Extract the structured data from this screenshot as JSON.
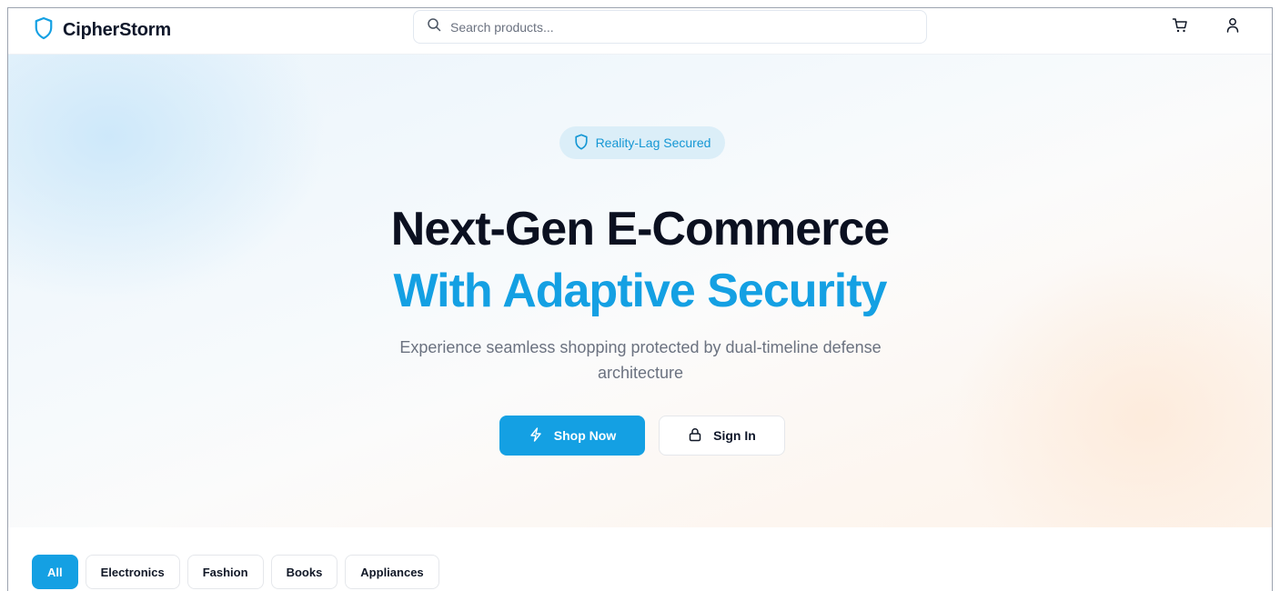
{
  "header": {
    "brand": "CipherStorm",
    "search_placeholder": "Search products..."
  },
  "hero": {
    "badge": "Reality-Lag Secured",
    "title_line1": "Next-Gen E-Commerce",
    "title_line2": "With Adaptive Security",
    "subtitle": "Experience seamless shopping protected by dual-timeline defense architecture",
    "primary_button": "Shop Now",
    "secondary_button": "Sign In"
  },
  "categories": {
    "items": [
      "All",
      "Electronics",
      "Fashion",
      "Books",
      "Appliances"
    ],
    "active": "All"
  },
  "colors": {
    "accent": "#14a0e3",
    "badge_bg": "#dbeef8",
    "text_dark": "#0b1020",
    "text_muted": "#6b7280"
  },
  "icons": {
    "brand": "shield-icon",
    "search": "search-icon",
    "cart": "cart-icon",
    "user": "user-icon",
    "badge": "shield-icon",
    "shop": "lightning-icon",
    "signin": "lock-icon"
  }
}
